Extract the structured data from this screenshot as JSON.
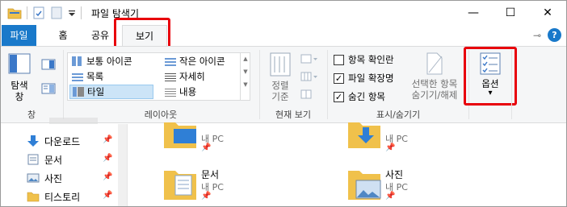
{
  "window": {
    "title": "파일 탐색기",
    "controls": {
      "minimize": "—",
      "maximize": "☐",
      "close": "✕"
    }
  },
  "tabs": {
    "file": "파일",
    "home": "홈",
    "share": "공유",
    "view": "보기",
    "help": "?",
    "pin_ribbon": "⊸"
  },
  "ribbon": {
    "pane": {
      "nav_pane": "탐색\n창",
      "group": "창"
    },
    "layout": {
      "items": {
        "large_icons": "보통 아이콘",
        "small_icons": "작은 아이콘",
        "list": "목록",
        "details": "자세히",
        "tiles": "타일",
        "content": "내용"
      },
      "group": "레이아웃"
    },
    "current_view": {
      "sort": "정렬\n기준",
      "group": "현재 보기"
    },
    "show_hide": {
      "item_checkboxes": "항목 확인란",
      "file_extensions": "파일 확장명",
      "hidden_items": "숨긴 항목",
      "hide_selected": "선택한 항목\n숨기기/해제",
      "group": "표시/숨기기"
    },
    "options": {
      "label": "옵션",
      "arrow": "▾"
    }
  },
  "nav": {
    "items": [
      {
        "label": "다운로드",
        "pinned": true
      },
      {
        "label": "문서",
        "pinned": true
      },
      {
        "label": "사진",
        "pinned": true
      },
      {
        "label": "티스토리",
        "pinned": true
      }
    ],
    "pin_glyph": "📌"
  },
  "content": {
    "tiles": [
      {
        "name": "",
        "location": "내 PC"
      },
      {
        "name": "",
        "location": "내 PC"
      },
      {
        "name": "문서",
        "location": "내 PC"
      },
      {
        "name": "사진",
        "location": "내 PC"
      }
    ]
  },
  "colors": {
    "accent": "#1979ca",
    "highlight_box": "#e8000b",
    "folder": "#f0c14b",
    "selection": "#cce4f7"
  }
}
